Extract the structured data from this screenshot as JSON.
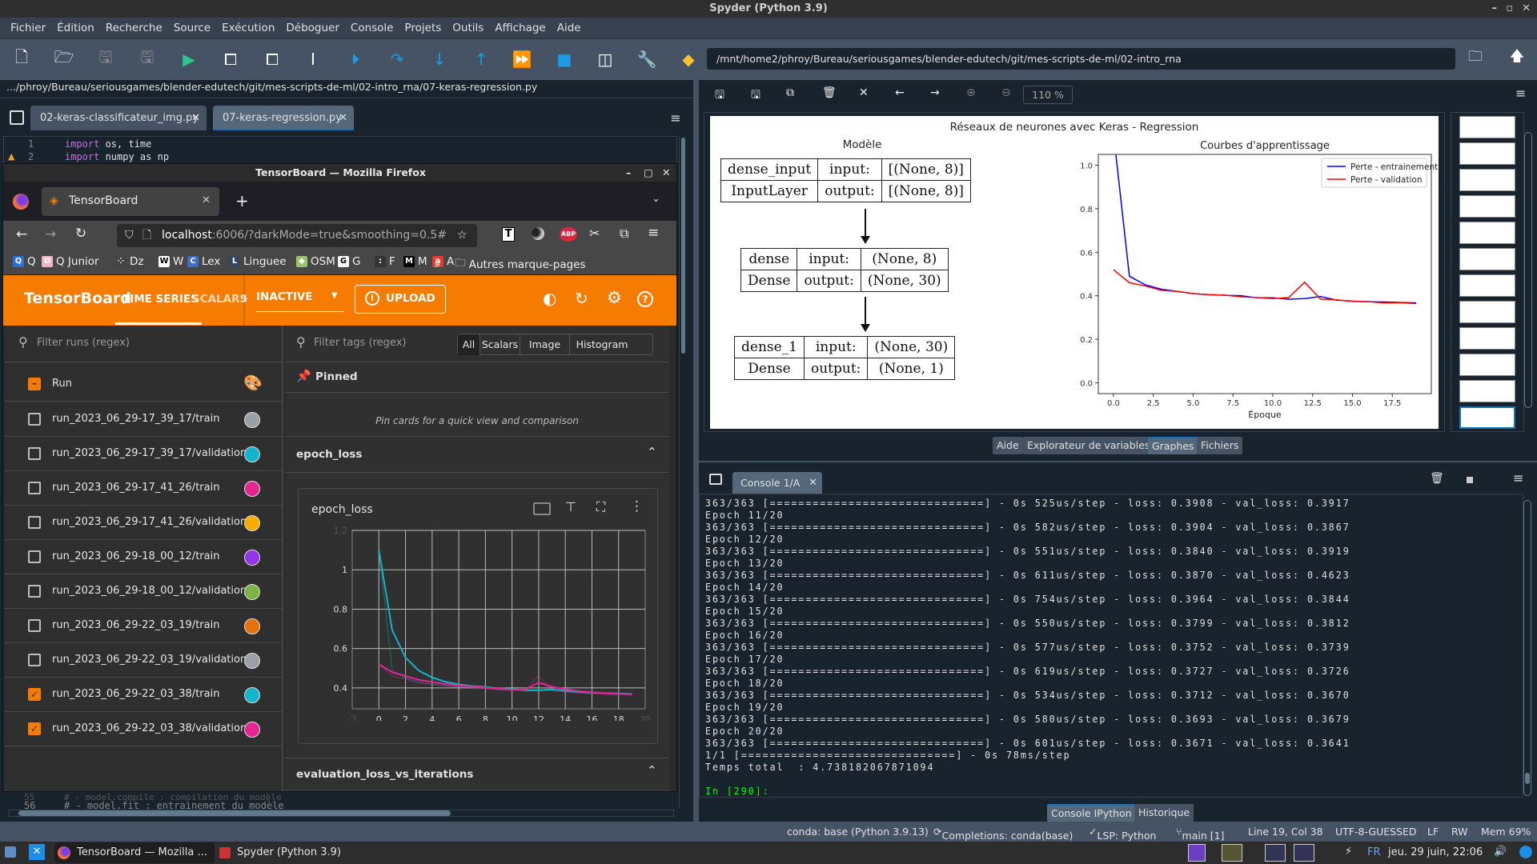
{
  "window": {
    "title": "Spyder (Python 3.9)"
  },
  "menu": [
    "Fichier",
    "Édition",
    "Recherche",
    "Source",
    "Exécution",
    "Déboguer",
    "Console",
    "Projets",
    "Outils",
    "Affichage",
    "Aide"
  ],
  "toolbar": {
    "icons": [
      "new-file",
      "open-file",
      "save",
      "save-all",
      "run",
      "run-cell",
      "run-cell-advance",
      "run-selection",
      "debug",
      "step",
      "step-into",
      "step-out",
      "continue",
      "stop",
      "maximize-pane",
      "preferences",
      "python-path"
    ],
    "working_dir": "/mnt/home2/phroy/Bureau/seriousgames/blender-edutech/git/mes-scripts-de-ml/02-intro_rna"
  },
  "editor": {
    "file_path": ".../phroy/Bureau/seriousgames/blender-edutech/git/mes-scripts-de-ml/02-intro_rna/07-keras-regression.py",
    "tabs": [
      {
        "label": "02-keras-classificateur_img.py"
      },
      {
        "label": "07-keras-regression.py",
        "active": true
      }
    ],
    "lines": [
      {
        "num": "1",
        "kw": "import",
        "rest": " os, time"
      },
      {
        "num": "2",
        "kw": "import",
        "rest": " numpy as np",
        "warning": true
      }
    ],
    "bottom_lines": [
      {
        "num": "55",
        "text": "# - model.compile : compilation du modèle"
      },
      {
        "num": "56",
        "text": "# - model.fit : entrainement du modèle"
      }
    ]
  },
  "firefox": {
    "title": "TensorBoard — Mozilla Firefox",
    "tab": "TensorBoard",
    "url_host": "localhost",
    "url_rest": ":6006/?darkMode=true&smoothing=0.5#",
    "bookmarks": [
      {
        "label": "Q",
        "icon": "Q",
        "color": "#2a6fdb"
      },
      {
        "label": "Q Junior",
        "icon": "ʘ",
        "color": "#f4b6c2"
      },
      {
        "label": "Dz",
        "icon": "⁘",
        "color": "#444"
      },
      {
        "label": "W",
        "icon": "W",
        "color": "#fff"
      },
      {
        "label": "Lex",
        "icon": "C",
        "color": "#3d6cc0"
      },
      {
        "label": "Linguee",
        "icon": "L",
        "color": "#34495e"
      },
      {
        "label": "OSM",
        "icon": "◆",
        "color": "#9bc26a"
      },
      {
        "label": "G",
        "icon": "G",
        "color": "#fff"
      },
      {
        "label": "F",
        "icon": ":",
        "color": "#333"
      },
      {
        "label": "M",
        "icon": "M",
        "color": "#000"
      },
      {
        "label": "A",
        "icon": "a",
        "color": "#e63c2f"
      }
    ],
    "other_bookmarks": "Autres marque-pages"
  },
  "tensorboard": {
    "brand": "TensorBoard",
    "nav": [
      "TIME SERIES",
      "SCALARS"
    ],
    "active_nav": "TIME SERIES",
    "plugin_select": "INACTIVE",
    "upload": "UPLOAD",
    "accent": "#f57c00",
    "filter_runs_placeholder": "Filter runs (regex)",
    "filter_tags_placeholder": "Filter tags (regex)",
    "run_header": "Run",
    "runs": [
      {
        "name": "run_2023_06_29-17_39_17/train",
        "checked": false,
        "color": "#9aa0a6"
      },
      {
        "name": "run_2023_06_29-17_39_17/validation",
        "checked": false,
        "color": "#12b5cb"
      },
      {
        "name": "run_2023_06_29-17_41_26/train",
        "checked": false,
        "color": "#e52592"
      },
      {
        "name": "run_2023_06_29-17_41_26/validation",
        "checked": false,
        "color": "#f9ab00"
      },
      {
        "name": "run_2023_06_29-18_00_12/train",
        "checked": false,
        "color": "#9334e6"
      },
      {
        "name": "run_2023_06_29-18_00_12/validation",
        "checked": false,
        "color": "#7cb342"
      },
      {
        "name": "run_2023_06_29-22_03_19/train",
        "checked": false,
        "color": "#e8710a"
      },
      {
        "name": "run_2023_06_29-22_03_19/validation",
        "checked": false,
        "color": "#9aa0a6"
      },
      {
        "name": "run_2023_06_29-22_03_38/train",
        "checked": true,
        "color": "#12b5cb"
      },
      {
        "name": "run_2023_06_29-22_03_38/validation",
        "checked": true,
        "color": "#e52592"
      }
    ],
    "tag_filters": [
      "All",
      "Scalars",
      "Image",
      "Histogram"
    ],
    "active_tag_filter": "All",
    "pinned": "Pinned",
    "pinned_hint": "Pin cards for a quick view and comparison",
    "section_epoch_loss": "epoch_loss",
    "card_title": "epoch_loss",
    "section_eval": "evaluation_loss_vs_iterations"
  },
  "plots": {
    "zoom": "110 %",
    "figure_title": "Réseaux de neurones avec Keras - Regression",
    "model_title": "Modèle",
    "model_layers": [
      {
        "name": "dense_input",
        "type": "InputLayer",
        "input": "[(None, 8)]",
        "output": "[(None, 8)]"
      },
      {
        "name": "dense",
        "type": "Dense",
        "input": "(None, 8)",
        "output": "(None, 30)"
      },
      {
        "name": "dense_1",
        "type": "Dense",
        "input": "(None, 30)",
        "output": "(None, 1)"
      }
    ],
    "input_label": "input:",
    "output_label": "output:",
    "thumbnail_count": 12
  },
  "right_tabs": [
    "Aide",
    "Explorateur de variables",
    "Graphes",
    "Fichiers"
  ],
  "active_right_tab": "Graphes",
  "console": {
    "tab": "Console 1/A",
    "lines": [
      "363/363 [==============================] - 0s 525us/step - loss: 0.3908 - val_loss: 0.3917",
      "Epoch 11/20",
      "363/363 [==============================] - 0s 582us/step - loss: 0.3904 - val_loss: 0.3867",
      "Epoch 12/20",
      "363/363 [==============================] - 0s 551us/step - loss: 0.3840 - val_loss: 0.3919",
      "Epoch 13/20",
      "363/363 [==============================] - 0s 611us/step - loss: 0.3870 - val_loss: 0.4623",
      "Epoch 14/20",
      "363/363 [==============================] - 0s 754us/step - loss: 0.3964 - val_loss: 0.3844",
      "Epoch 15/20",
      "363/363 [==============================] - 0s 550us/step - loss: 0.3799 - val_loss: 0.3812",
      "Epoch 16/20",
      "363/363 [==============================] - 0s 577us/step - loss: 0.3752 - val_loss: 0.3739",
      "Epoch 17/20",
      "363/363 [==============================] - 0s 619us/step - loss: 0.3727 - val_loss: 0.3726",
      "Epoch 18/20",
      "363/363 [==============================] - 0s 534us/step - loss: 0.3712 - val_loss: 0.3670",
      "Epoch 19/20",
      "363/363 [==============================] - 0s 580us/step - loss: 0.3693 - val_loss: 0.3679",
      "Epoch 20/20",
      "363/363 [==============================] - 0s 601us/step - loss: 0.3671 - val_loss: 0.3641",
      "1/1 [==============================] - 0s 78ms/step",
      "Temps total  : 4.738182067871094",
      ""
    ],
    "prompt": "In [290]:"
  },
  "bottom_tabs": [
    "Console IPython",
    "Historique"
  ],
  "active_bottom_tab": "Console IPython",
  "status": {
    "conda": "conda: base (Python 3.9.13)",
    "completions": "Completions: conda(base)",
    "lsp": "LSP: Python",
    "git": "main [1]",
    "cursor": "Line 19, Col 38",
    "encoding": "UTF-8-GUESSED",
    "eol": "LF",
    "rw": "RW",
    "mem": "Mem 69%"
  },
  "taskbar": {
    "tasks": [
      "TensorBoard — Mozilla ...",
      "Spyder (Python 3.9)"
    ],
    "keyboard": "FR",
    "clock": "jeu. 29 juin, 22:06"
  },
  "chart_data": [
    {
      "type": "line",
      "title": "Courbes d'apprentissage",
      "xlabel": "Époque",
      "ylabel": "",
      "xlim": [
        -0.95,
        19.95
      ],
      "ylim": [
        -0.05,
        1.05
      ],
      "xticks": [
        "0.0",
        "2.5",
        "5.0",
        "7.5",
        "10.0",
        "12.5",
        "15.0",
        "17.5"
      ],
      "yticks": [
        "0.0",
        "0.2",
        "0.4",
        "0.6",
        "0.8",
        "1.0"
      ],
      "legend": "top-right",
      "x": [
        0,
        1,
        2,
        3,
        4,
        5,
        6,
        7,
        8,
        9,
        10,
        11,
        12,
        13,
        14,
        15,
        16,
        17,
        18,
        19
      ],
      "series": [
        {
          "name": "Perte - entrainement",
          "color": "#0000ff",
          "values": [
            1.15,
            0.49,
            0.45,
            0.43,
            0.42,
            0.41,
            0.405,
            0.402,
            0.4,
            0.3908,
            0.3904,
            0.384,
            0.387,
            0.3964,
            0.3799,
            0.3752,
            0.3727,
            0.3712,
            0.3693,
            0.3671
          ]
        },
        {
          "name": "Perte - validation",
          "color": "#ff0000",
          "values": [
            0.52,
            0.46,
            0.445,
            0.425,
            0.42,
            0.41,
            0.405,
            0.403,
            0.395,
            0.3917,
            0.3867,
            0.3919,
            0.4623,
            0.3844,
            0.3812,
            0.3739,
            0.3726,
            0.367,
            0.3679,
            0.3641
          ]
        }
      ]
    },
    {
      "type": "line",
      "title": "epoch_loss",
      "smoothing": 0.5,
      "xlim": [
        -2,
        20
      ],
      "ylim": [
        0.294,
        1.2
      ],
      "xticks": [
        "-2",
        "0",
        "2",
        "4",
        "6",
        "8",
        "10",
        "12",
        "14",
        "16",
        "18",
        "20"
      ],
      "yticks": [
        "0.4",
        "0.6",
        "0.8",
        "1",
        "1.2"
      ],
      "grid": true,
      "x": [
        0,
        1,
        2,
        3,
        4,
        5,
        6,
        7,
        8,
        9,
        10,
        11,
        12,
        13,
        14,
        15,
        16,
        17,
        18,
        19
      ],
      "series": [
        {
          "color": "#12b5cb",
          "values": [
            1.1,
            0.49,
            0.45,
            0.43,
            0.42,
            0.41,
            0.405,
            0.402,
            0.4,
            0.3908,
            0.3904,
            0.384,
            0.387,
            0.3964,
            0.3799,
            0.3752,
            0.3727,
            0.3712,
            0.3693,
            0.3671
          ]
        },
        {
          "color": "#e52592",
          "values": [
            0.52,
            0.46,
            0.445,
            0.425,
            0.42,
            0.41,
            0.405,
            0.403,
            0.395,
            0.3917,
            0.3867,
            0.3919,
            0.4623,
            0.3844,
            0.3812,
            0.3739,
            0.3726,
            0.367,
            0.3679,
            0.3641
          ]
        }
      ]
    }
  ]
}
